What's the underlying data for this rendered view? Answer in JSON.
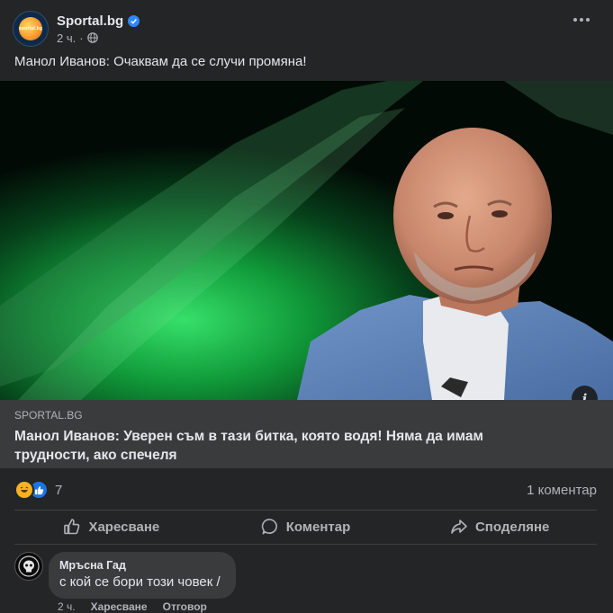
{
  "post": {
    "page_name": "Sportal.bg",
    "logo_text": "sportal.bg",
    "time": "2 ч.",
    "separator": "·",
    "caption": "Манол Иванов: Очаквам да се случи промяна!",
    "link": {
      "domain": "SPORTAL.BG",
      "title": "Манол Иванов: Уверен съм в тази битка, която водя! Няма да имам трудности, ако спечеля",
      "info_label": "i"
    },
    "reactions": {
      "icons": [
        "haha-icon",
        "like-icon"
      ],
      "count": "7"
    },
    "comments_count": "1 коментар",
    "actions": {
      "like": "Харесване",
      "comment": "Коментар",
      "share": "Споделяне"
    }
  },
  "comment": {
    "author": "Мръсна Гад",
    "text": "с кой се бори този човек /",
    "time": "2 ч.",
    "like": "Харесване",
    "reply": "Отговор"
  },
  "colors": {
    "background": "#242526",
    "link_footer": "#3a3b3c",
    "text_primary": "#e4e6eb",
    "text_secondary": "#b0b3b8",
    "verified": "#2d88ff"
  }
}
